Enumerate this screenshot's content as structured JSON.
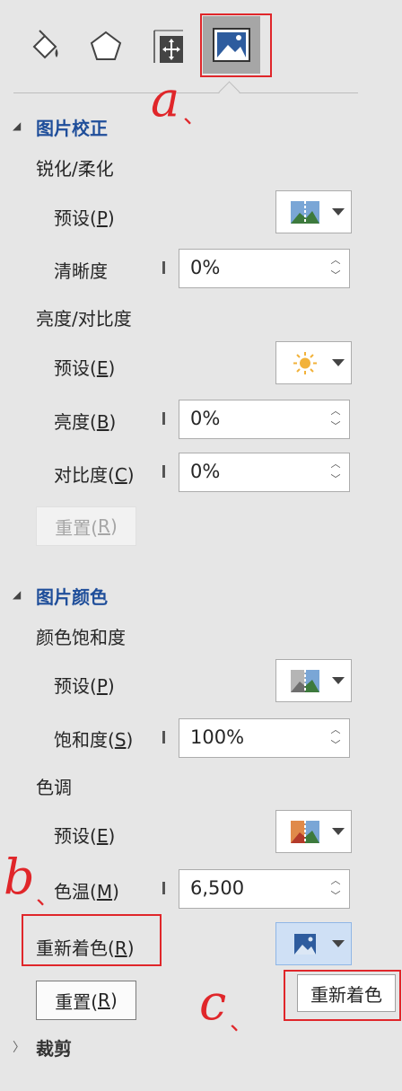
{
  "annotations": {
    "a": "a",
    "b": "b",
    "c": "c",
    "tick": "、"
  },
  "tabs": [
    {
      "name": "fill-line-tab",
      "icon": "paint-bucket-icon"
    },
    {
      "name": "effects-tab",
      "icon": "pentagon-icon"
    },
    {
      "name": "size-properties-tab",
      "icon": "size-move-icon"
    },
    {
      "name": "picture-tab",
      "icon": "picture-icon",
      "active": true
    }
  ],
  "picture_correction": {
    "title": "图片校正",
    "sharpen_soften": {
      "heading": "锐化/柔化",
      "preset_label": "预设(P)",
      "clarity_label": "清晰度",
      "clarity_value": "0%"
    },
    "brightness_contrast": {
      "heading": "亮度/对比度",
      "preset_label": "预设(E)",
      "brightness_label": "亮度(B)",
      "brightness_value": "0%",
      "contrast_label": "对比度(C)",
      "contrast_value": "0%"
    },
    "reset_label": "重置(R)"
  },
  "picture_color": {
    "title": "图片颜色",
    "saturation": {
      "heading": "颜色饱和度",
      "preset_label": "预设(P)",
      "saturation_label": "饱和度(S)",
      "saturation_value": "100%"
    },
    "tone": {
      "heading": "色调",
      "preset_label": "预设(E)",
      "temperature_label": "色温(M)",
      "temperature_value": "6,500"
    },
    "recolor_label": "重新着色(R)",
    "recolor_tooltip": "重新着色",
    "reset_label": "重置(R)"
  },
  "crop": {
    "title": "裁剪"
  },
  "colors": {
    "accent": "#1f4e9a",
    "annotation_red": "#e0262a",
    "active_tab": "#a6a6a6"
  }
}
